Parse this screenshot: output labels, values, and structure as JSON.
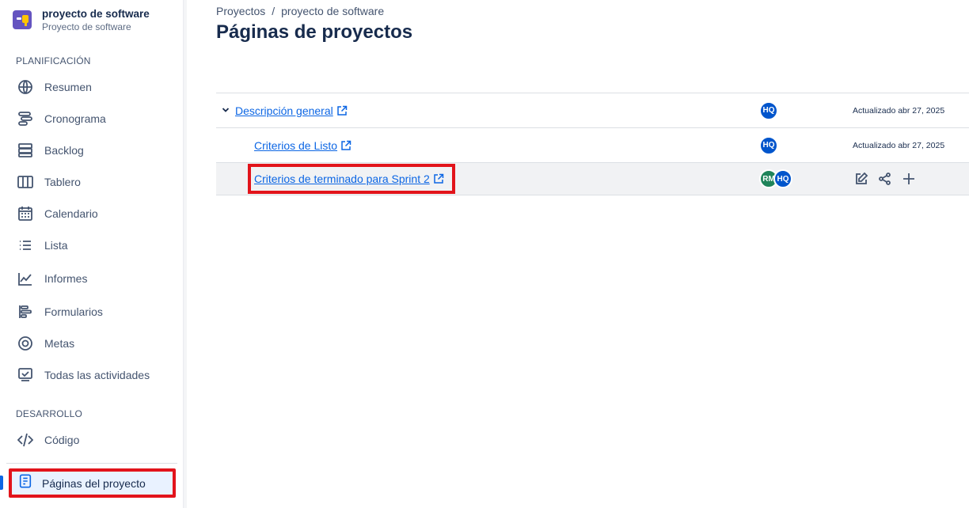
{
  "project": {
    "name": "proyecto de software",
    "subtitle": "Proyecto de software"
  },
  "sidebar": {
    "section_planning": "PLANIFICACIÓN",
    "section_dev": "DESARROLLO",
    "items": [
      {
        "label": "Resumen",
        "icon": "globe-icon"
      },
      {
        "label": "Cronograma",
        "icon": "timeline-icon"
      },
      {
        "label": "Backlog",
        "icon": "backlog-icon"
      },
      {
        "label": "Tablero",
        "icon": "board-icon"
      },
      {
        "label": "Calendario",
        "icon": "calendar-icon"
      },
      {
        "label": "Lista",
        "icon": "list-icon"
      },
      {
        "label": "Informes",
        "icon": "chart-icon"
      },
      {
        "label": "Formularios",
        "icon": "forms-icon"
      },
      {
        "label": "Metas",
        "icon": "target-icon"
      },
      {
        "label": "Todas las actividades",
        "icon": "activity-icon"
      },
      {
        "label": "Código",
        "icon": "code-icon"
      },
      {
        "label": "Páginas del proyecto",
        "icon": "page-icon",
        "active": true
      }
    ]
  },
  "breadcrumb": {
    "items": [
      "Proyectos",
      "proyecto de software"
    ],
    "separator": "/"
  },
  "page_title": "Páginas de proyectos",
  "pages": [
    {
      "title": "Descripción general",
      "avatars": [
        "HQ"
      ],
      "updated": "Actualizado abr 27, 2025",
      "expanded": true
    },
    {
      "title": "Criterios de Listo",
      "avatars": [
        "HQ"
      ],
      "updated": "Actualizado abr 27, 2025"
    },
    {
      "title": "Criterios de terminado para Sprint 2",
      "avatars": [
        "RM",
        "HQ"
      ],
      "hovered": true
    }
  ],
  "colors": {
    "accent": "#0c66e4",
    "highlight": "#e2141b",
    "avatar_hq": "#0055cc",
    "avatar_rm": "#1f845a"
  }
}
